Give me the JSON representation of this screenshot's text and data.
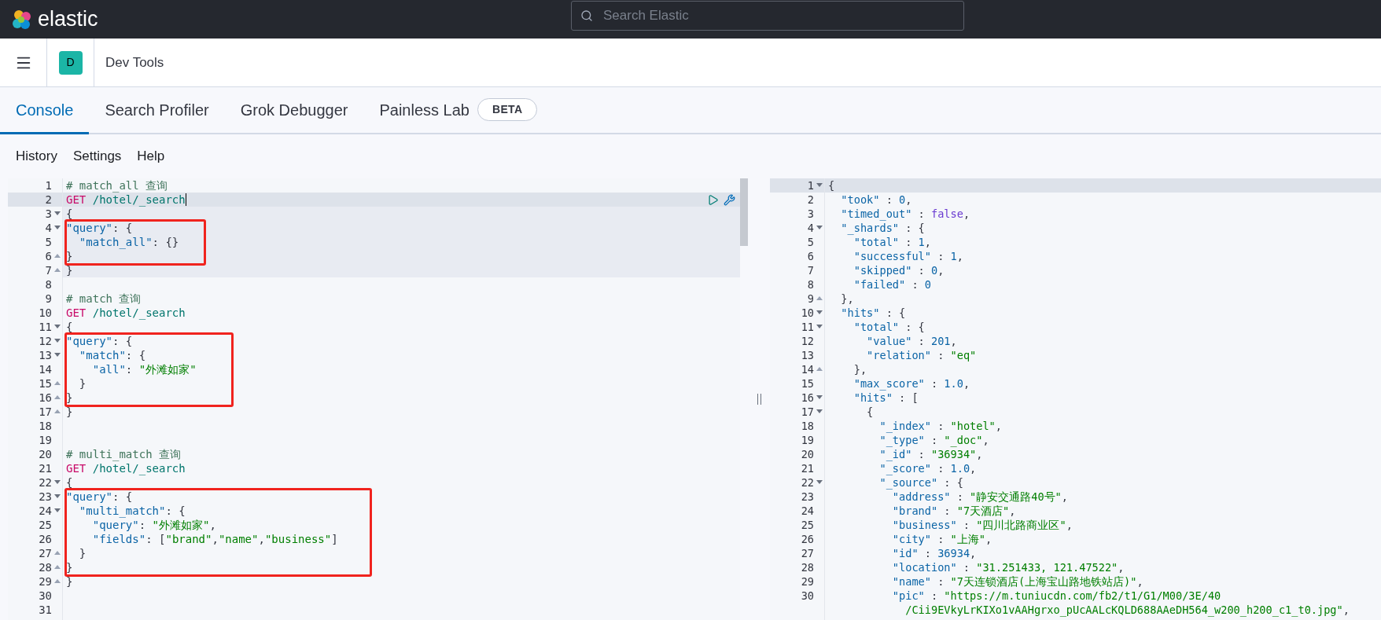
{
  "top_bar": {
    "logo_text": "elastic",
    "search": {
      "placeholder": "Search Elastic"
    }
  },
  "header": {
    "space_avatar": "D",
    "title": "Dev Tools"
  },
  "tabs": [
    {
      "label": "Console",
      "selected": true
    },
    {
      "label": "Search Profiler",
      "selected": false
    },
    {
      "label": "Grok Debugger",
      "selected": false
    },
    {
      "label": "Painless Lab",
      "selected": false,
      "badge": "BETA"
    }
  ],
  "console_menu": [
    "History",
    "Settings",
    "Help"
  ],
  "request_editor": {
    "lines": [
      {
        "number": "1",
        "tokens": [
          {
            "kind": "comment",
            "text": "# match_all 查询"
          }
        ],
        "highlighted": false,
        "cursor": false,
        "marked": false
      },
      {
        "number": "2",
        "tokens": [
          {
            "kind": "method",
            "text": "GET"
          },
          {
            "kind": "url",
            "text": " /hotel/_search"
          }
        ],
        "highlighted": true,
        "cursor": true,
        "marked": false,
        "actions": true
      },
      {
        "number": "3",
        "fold_open": true,
        "tokens": [
          {
            "kind": "punct",
            "text": "{"
          }
        ],
        "highlighted": true,
        "cursor": false,
        "marked": false
      },
      {
        "number": "4",
        "fold_open": true,
        "tokens": [
          {
            "kind": "key",
            "text": "\"query\""
          },
          {
            "kind": "punct",
            "text": ": {"
          }
        ],
        "highlighted": true,
        "cursor": false,
        "marked": true
      },
      {
        "number": "5",
        "tokens": [
          {
            "kind": "key",
            "text": "  \"match_all\""
          },
          {
            "kind": "punct",
            "text": ": {}"
          }
        ],
        "highlighted": true,
        "cursor": false,
        "marked": true
      },
      {
        "number": "6",
        "fold_close": true,
        "tokens": [
          {
            "kind": "punct",
            "text": "}"
          }
        ],
        "highlighted": true,
        "cursor": false,
        "marked": true
      },
      {
        "number": "7",
        "fold_close": true,
        "tokens": [
          {
            "kind": "punct",
            "text": "}"
          }
        ],
        "highlighted": true,
        "cursor": false,
        "marked": false
      },
      {
        "number": "8",
        "highlighted": false,
        "cursor": false,
        "marked": false
      },
      {
        "number": "9",
        "tokens": [
          {
            "kind": "comment",
            "text": "# match 查询"
          }
        ],
        "highlighted": false,
        "cursor": false,
        "marked": false
      },
      {
        "number": "10",
        "tokens": [
          {
            "kind": "method",
            "text": "GET"
          },
          {
            "kind": "url",
            "text": " /hotel/_search"
          }
        ],
        "highlighted": false,
        "cursor": false,
        "marked": false
      },
      {
        "number": "11",
        "fold_open": true,
        "tokens": [
          {
            "kind": "punct",
            "text": "{"
          }
        ],
        "highlighted": false,
        "cursor": false,
        "marked": false
      },
      {
        "number": "12",
        "fold_open": true,
        "tokens": [
          {
            "kind": "key",
            "text": "\"query\""
          },
          {
            "kind": "punct",
            "text": ": {"
          }
        ],
        "highlighted": false,
        "cursor": false,
        "marked": true
      },
      {
        "number": "13",
        "fold_open": true,
        "tokens": [
          {
            "kind": "key",
            "text": "  \"match\""
          },
          {
            "kind": "punct",
            "text": ": {"
          }
        ],
        "highlighted": false,
        "cursor": false,
        "marked": true
      },
      {
        "number": "14",
        "tokens": [
          {
            "kind": "key",
            "text": "    \"all\""
          },
          {
            "kind": "punct",
            "text": ": "
          },
          {
            "kind": "string",
            "text": "\"外滩如家\""
          }
        ],
        "highlighted": false,
        "cursor": false,
        "marked": true
      },
      {
        "number": "15",
        "fold_close": true,
        "tokens": [
          {
            "kind": "punct",
            "text": "  }"
          }
        ],
        "highlighted": false,
        "cursor": false,
        "marked": true
      },
      {
        "number": "16",
        "fold_close": true,
        "tokens": [
          {
            "kind": "punct",
            "text": "}"
          }
        ],
        "highlighted": false,
        "cursor": false,
        "marked": true
      },
      {
        "number": "17",
        "fold_close": true,
        "tokens": [
          {
            "kind": "punct",
            "text": "}"
          }
        ],
        "highlighted": false,
        "cursor": false,
        "marked": false
      },
      {
        "number": "18",
        "highlighted": false,
        "cursor": false,
        "marked": false
      },
      {
        "number": "19",
        "highlighted": false,
        "cursor": false,
        "marked": false
      },
      {
        "number": "20",
        "tokens": [
          {
            "kind": "comment",
            "text": "# multi_match 查询"
          }
        ],
        "highlighted": false,
        "cursor": false,
        "marked": false
      },
      {
        "number": "21",
        "tokens": [
          {
            "kind": "method",
            "text": "GET"
          },
          {
            "kind": "url",
            "text": " /hotel/_search"
          }
        ],
        "highlighted": false,
        "cursor": false,
        "marked": false
      },
      {
        "number": "22",
        "fold_open": true,
        "tokens": [
          {
            "kind": "punct",
            "text": "{"
          }
        ],
        "highlighted": false,
        "cursor": false,
        "marked": false
      },
      {
        "number": "23",
        "fold_open": true,
        "tokens": [
          {
            "kind": "key",
            "text": "\"query\""
          },
          {
            "kind": "punct",
            "text": ": {"
          }
        ],
        "highlighted": false,
        "cursor": false,
        "marked": true
      },
      {
        "number": "24",
        "fold_open": true,
        "tokens": [
          {
            "kind": "key",
            "text": "  \"multi_match\""
          },
          {
            "kind": "punct",
            "text": ": {"
          }
        ],
        "highlighted": false,
        "cursor": false,
        "marked": true
      },
      {
        "number": "25",
        "tokens": [
          {
            "kind": "key",
            "text": "    \"query\""
          },
          {
            "kind": "punct",
            "text": ": "
          },
          {
            "kind": "string",
            "text": "\"外滩如家\""
          },
          {
            "kind": "punct",
            "text": ","
          }
        ],
        "highlighted": false,
        "cursor": false,
        "marked": true
      },
      {
        "number": "26",
        "tokens": [
          {
            "kind": "key",
            "text": "    \"fields\""
          },
          {
            "kind": "punct",
            "text": ": ["
          },
          {
            "kind": "string",
            "text": "\"brand\""
          },
          {
            "kind": "punct",
            "text": ","
          },
          {
            "kind": "string",
            "text": "\"name\""
          },
          {
            "kind": "punct",
            "text": ","
          },
          {
            "kind": "string",
            "text": "\"business\""
          },
          {
            "kind": "punct",
            "text": "]"
          }
        ],
        "highlighted": false,
        "cursor": false,
        "marked": true
      },
      {
        "number": "27",
        "fold_close": true,
        "tokens": [
          {
            "kind": "punct",
            "text": "  }"
          }
        ],
        "highlighted": false,
        "cursor": false,
        "marked": true
      },
      {
        "number": "28",
        "fold_close": true,
        "tokens": [
          {
            "kind": "punct",
            "text": "}"
          }
        ],
        "highlighted": false,
        "cursor": false,
        "marked": true
      },
      {
        "number": "29",
        "fold_close": true,
        "tokens": [
          {
            "kind": "punct",
            "text": "}"
          }
        ],
        "highlighted": false,
        "cursor": false,
        "marked": false
      },
      {
        "number": "30",
        "highlighted": false,
        "cursor": false,
        "marked": false
      },
      {
        "number": "31",
        "highlighted": false,
        "cursor": false,
        "marked": false
      }
    ]
  },
  "response_editor": {
    "lines": [
      {
        "number": "1",
        "fold_open": true,
        "tokens": [
          {
            "kind": "punct",
            "text": "{"
          }
        ],
        "cursor": true
      },
      {
        "number": "2",
        "tokens": [
          {
            "kind": "key",
            "text": "  \"took\""
          },
          {
            "kind": "punct",
            "text": " : "
          },
          {
            "kind": "number",
            "text": "0"
          },
          {
            "kind": "punct",
            "text": ","
          }
        ],
        "cursor": false
      },
      {
        "number": "3",
        "tokens": [
          {
            "kind": "key",
            "text": "  \"timed_out\""
          },
          {
            "kind": "punct",
            "text": " : "
          },
          {
            "kind": "boolean",
            "text": "false"
          },
          {
            "kind": "punct",
            "text": ","
          }
        ],
        "cursor": false
      },
      {
        "number": "4",
        "fold_open": true,
        "tokens": [
          {
            "kind": "key",
            "text": "  \"_shards\""
          },
          {
            "kind": "punct",
            "text": " : {"
          }
        ],
        "cursor": false
      },
      {
        "number": "5",
        "tokens": [
          {
            "kind": "key",
            "text": "    \"total\""
          },
          {
            "kind": "punct",
            "text": " : "
          },
          {
            "kind": "number",
            "text": "1"
          },
          {
            "kind": "punct",
            "text": ","
          }
        ],
        "cursor": false
      },
      {
        "number": "6",
        "tokens": [
          {
            "kind": "key",
            "text": "    \"successful\""
          },
          {
            "kind": "punct",
            "text": " : "
          },
          {
            "kind": "number",
            "text": "1"
          },
          {
            "kind": "punct",
            "text": ","
          }
        ],
        "cursor": false
      },
      {
        "number": "7",
        "tokens": [
          {
            "kind": "key",
            "text": "    \"skipped\""
          },
          {
            "kind": "punct",
            "text": " : "
          },
          {
            "kind": "number",
            "text": "0"
          },
          {
            "kind": "punct",
            "text": ","
          }
        ],
        "cursor": false
      },
      {
        "number": "8",
        "tokens": [
          {
            "kind": "key",
            "text": "    \"failed\""
          },
          {
            "kind": "punct",
            "text": " : "
          },
          {
            "kind": "number",
            "text": "0"
          }
        ],
        "cursor": false
      },
      {
        "number": "9",
        "fold_close": true,
        "tokens": [
          {
            "kind": "punct",
            "text": "  },"
          }
        ],
        "cursor": false
      },
      {
        "number": "10",
        "fold_open": true,
        "tokens": [
          {
            "kind": "key",
            "text": "  \"hits\""
          },
          {
            "kind": "punct",
            "text": " : {"
          }
        ],
        "cursor": false
      },
      {
        "number": "11",
        "fold_open": true,
        "tokens": [
          {
            "kind": "key",
            "text": "    \"total\""
          },
          {
            "kind": "punct",
            "text": " : {"
          }
        ],
        "cursor": false
      },
      {
        "number": "12",
        "tokens": [
          {
            "kind": "key",
            "text": "      \"value\""
          },
          {
            "kind": "punct",
            "text": " : "
          },
          {
            "kind": "number",
            "text": "201"
          },
          {
            "kind": "punct",
            "text": ","
          }
        ],
        "cursor": false
      },
      {
        "number": "13",
        "tokens": [
          {
            "kind": "key",
            "text": "      \"relation\""
          },
          {
            "kind": "punct",
            "text": " : "
          },
          {
            "kind": "string",
            "text": "\"eq\""
          }
        ],
        "cursor": false
      },
      {
        "number": "14",
        "fold_close": true,
        "tokens": [
          {
            "kind": "punct",
            "text": "    },"
          }
        ],
        "cursor": false
      },
      {
        "number": "15",
        "tokens": [
          {
            "kind": "key",
            "text": "    \"max_score\""
          },
          {
            "kind": "punct",
            "text": " : "
          },
          {
            "kind": "number",
            "text": "1.0"
          },
          {
            "kind": "punct",
            "text": ","
          }
        ],
        "cursor": false
      },
      {
        "number": "16",
        "fold_open": true,
        "tokens": [
          {
            "kind": "key",
            "text": "    \"hits\""
          },
          {
            "kind": "punct",
            "text": " : ["
          }
        ],
        "cursor": false
      },
      {
        "number": "17",
        "fold_open": true,
        "tokens": [
          {
            "kind": "punct",
            "text": "      {"
          }
        ],
        "cursor": false
      },
      {
        "number": "18",
        "tokens": [
          {
            "kind": "key",
            "text": "        \"_index\""
          },
          {
            "kind": "punct",
            "text": " : "
          },
          {
            "kind": "string",
            "text": "\"hotel\""
          },
          {
            "kind": "punct",
            "text": ","
          }
        ],
        "cursor": false
      },
      {
        "number": "19",
        "tokens": [
          {
            "kind": "key",
            "text": "        \"_type\""
          },
          {
            "kind": "punct",
            "text": " : "
          },
          {
            "kind": "string",
            "text": "\"_doc\""
          },
          {
            "kind": "punct",
            "text": ","
          }
        ],
        "cursor": false
      },
      {
        "number": "20",
        "tokens": [
          {
            "kind": "key",
            "text": "        \"_id\""
          },
          {
            "kind": "punct",
            "text": " : "
          },
          {
            "kind": "string",
            "text": "\"36934\""
          },
          {
            "kind": "punct",
            "text": ","
          }
        ],
        "cursor": false
      },
      {
        "number": "21",
        "tokens": [
          {
            "kind": "key",
            "text": "        \"_score\""
          },
          {
            "kind": "punct",
            "text": " : "
          },
          {
            "kind": "number",
            "text": "1.0"
          },
          {
            "kind": "punct",
            "text": ","
          }
        ],
        "cursor": false
      },
      {
        "number": "22",
        "fold_open": true,
        "tokens": [
          {
            "kind": "key",
            "text": "        \"_source\""
          },
          {
            "kind": "punct",
            "text": " : {"
          }
        ],
        "cursor": false
      },
      {
        "number": "23",
        "tokens": [
          {
            "kind": "key",
            "text": "          \"address\""
          },
          {
            "kind": "punct",
            "text": " : "
          },
          {
            "kind": "string",
            "text": "\"静安交通路40号\""
          },
          {
            "kind": "punct",
            "text": ","
          }
        ],
        "cursor": false
      },
      {
        "number": "24",
        "tokens": [
          {
            "kind": "key",
            "text": "          \"brand\""
          },
          {
            "kind": "punct",
            "text": " : "
          },
          {
            "kind": "string",
            "text": "\"7天酒店\""
          },
          {
            "kind": "punct",
            "text": ","
          }
        ],
        "cursor": false
      },
      {
        "number": "25",
        "tokens": [
          {
            "kind": "key",
            "text": "          \"business\""
          },
          {
            "kind": "punct",
            "text": " : "
          },
          {
            "kind": "string",
            "text": "\"四川北路商业区\""
          },
          {
            "kind": "punct",
            "text": ","
          }
        ],
        "cursor": false
      },
      {
        "number": "26",
        "tokens": [
          {
            "kind": "key",
            "text": "          \"city\""
          },
          {
            "kind": "punct",
            "text": " : "
          },
          {
            "kind": "string",
            "text": "\"上海\""
          },
          {
            "kind": "punct",
            "text": ","
          }
        ],
        "cursor": false
      },
      {
        "number": "27",
        "tokens": [
          {
            "kind": "key",
            "text": "          \"id\""
          },
          {
            "kind": "punct",
            "text": " : "
          },
          {
            "kind": "number",
            "text": "36934"
          },
          {
            "kind": "punct",
            "text": ","
          }
        ],
        "cursor": false
      },
      {
        "number": "28",
        "tokens": [
          {
            "kind": "key",
            "text": "          \"location\""
          },
          {
            "kind": "punct",
            "text": " : "
          },
          {
            "kind": "string",
            "text": "\"31.251433, 121.47522\""
          },
          {
            "kind": "punct",
            "text": ","
          }
        ],
        "cursor": false
      },
      {
        "number": "29",
        "tokens": [
          {
            "kind": "key",
            "text": "          \"name\""
          },
          {
            "kind": "punct",
            "text": " : "
          },
          {
            "kind": "string",
            "text": "\"7天连锁酒店(上海宝山路地铁站店)\""
          },
          {
            "kind": "punct",
            "text": ","
          }
        ],
        "cursor": false
      },
      {
        "number": "30",
        "tokens": [
          {
            "kind": "key",
            "text": "          \"pic\""
          },
          {
            "kind": "punct",
            "text": " : "
          },
          {
            "kind": "string",
            "text": "\"https://m.tuniucdn.com/fb2/t1/G1/M00/3E/40"
          }
        ],
        "continuation": [
          {
            "kind": "string",
            "text": "            /Cii9EVkyLrKIXo1vAAHgrxo_pUcAALcKQLD688AAeDH564_w200_h200_c1_t0.jpg\""
          },
          {
            "kind": "punct",
            "text": ","
          }
        ],
        "cursor": false
      }
    ]
  }
}
